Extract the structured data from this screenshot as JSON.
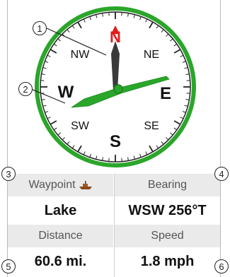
{
  "compass": {
    "north": "N",
    "south": "S",
    "east": "E",
    "west": "W",
    "northeast": "NE",
    "northwest": "NW",
    "southeast": "SE",
    "southwest": "SW",
    "ring_color": "#2aa62a",
    "needle_color": "#3a3a3a",
    "bearing_pointer_color": "#2aa62a",
    "north_color": "#e31b1b"
  },
  "callouts": [
    "1",
    "2",
    "3",
    "4",
    "5",
    "6"
  ],
  "fields": {
    "waypoint_label": "Waypoint",
    "waypoint_value": "Lake",
    "waypoint_icon": "boat-icon",
    "bearing_label": "Bearing",
    "bearing_value": "WSW 256°T",
    "distance_label": "Distance",
    "distance_value": "60.6 mi.",
    "speed_label": "Speed",
    "speed_value": "1.8 mph"
  }
}
